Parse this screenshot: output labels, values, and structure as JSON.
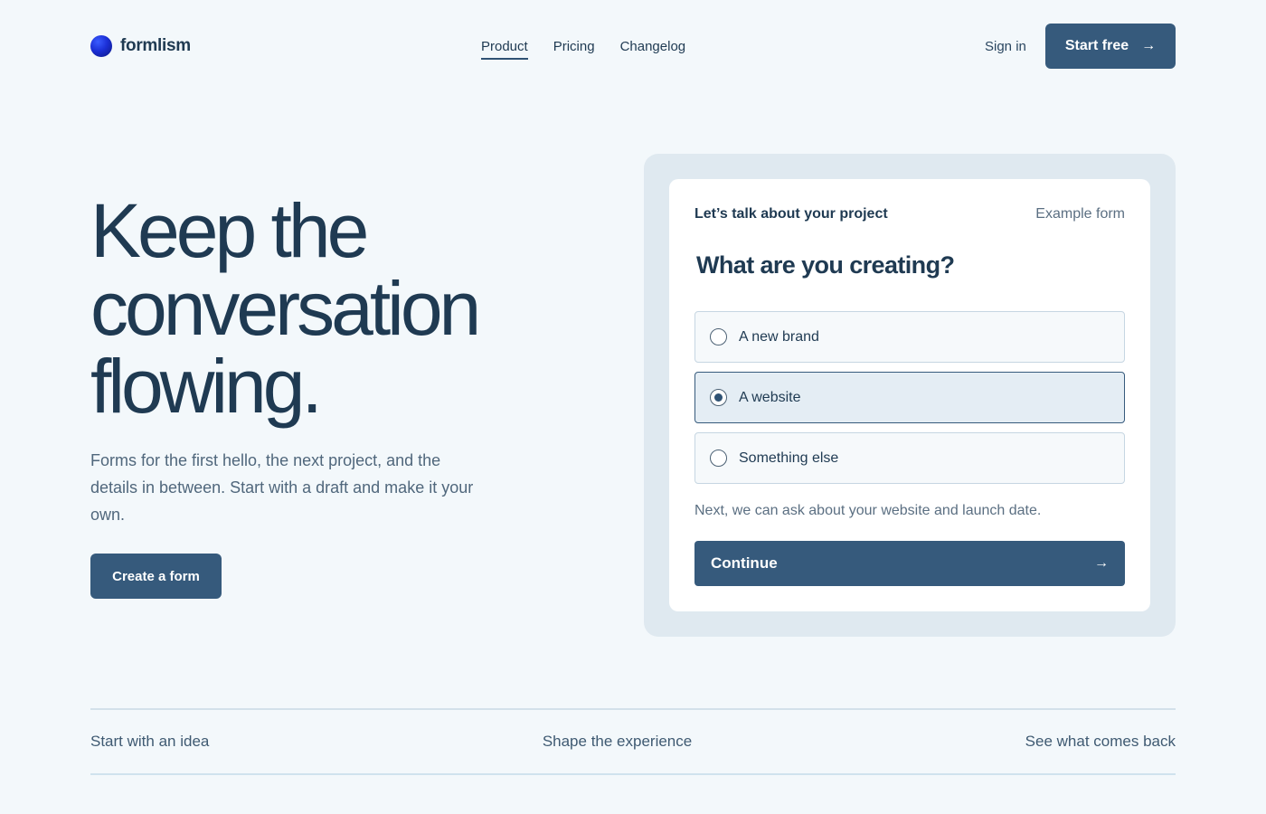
{
  "brand": {
    "name": "formlism",
    "icon": "brand-dot-icon",
    "accent": "#1b2fd6"
  },
  "nav": {
    "items": [
      {
        "label": "Product",
        "active": true
      },
      {
        "label": "Pricing",
        "active": false
      },
      {
        "label": "Changelog",
        "active": false
      }
    ]
  },
  "header": {
    "sign_in": "Sign in",
    "start_free": "Start free",
    "start_free_icon": "arrow-right-icon"
  },
  "hero": {
    "title_lines": [
      "Keep the",
      "conversation",
      "flowing."
    ],
    "subtitle": "Forms for the first hello, the next project, and the details in between. Start with a draft and make it your own.",
    "cta": "Create a form"
  },
  "form_card": {
    "eyebrow": "Let’s talk about your project",
    "tag": "Example form",
    "question": "What are you creating?",
    "options": [
      {
        "label": "A new brand",
        "selected": false
      },
      {
        "label": "A website",
        "selected": true
      },
      {
        "label": "Something else",
        "selected": false
      }
    ],
    "hint": "Next, we can ask about your website and launch date.",
    "continue": "Continue",
    "continue_icon": "arrow-right-icon"
  },
  "steps": [
    "Start with an idea",
    "Shape the experience",
    "See what comes back"
  ],
  "colors": {
    "background": "#f3f8fb",
    "primary": "#365a7c",
    "text": "#1f3a52",
    "muted": "#50677c",
    "card_frame": "#dfe9f0"
  }
}
